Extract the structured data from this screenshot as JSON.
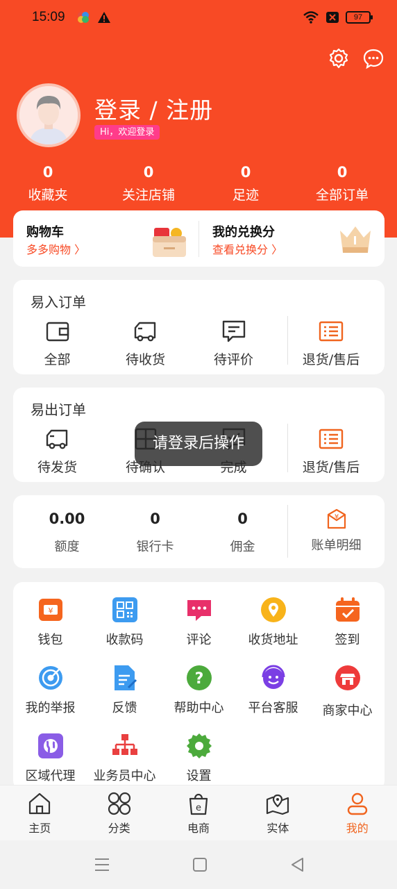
{
  "status": {
    "time": "15:09",
    "battery": "97"
  },
  "profile": {
    "login_text": "登录 / 注册",
    "welcome": "Hi，欢迎登录"
  },
  "stats": [
    {
      "value": "0",
      "label": "收藏夹"
    },
    {
      "value": "0",
      "label": "关注店铺"
    },
    {
      "value": "0",
      "label": "足迹"
    },
    {
      "value": "0",
      "label": "全部订单"
    }
  ],
  "promo": {
    "cart": {
      "title": "购物车",
      "sub": "多多购物 〉"
    },
    "points": {
      "title": "我的兑换分",
      "sub": "查看兑换分 〉"
    }
  },
  "orders_in": {
    "title": "易入订单",
    "items": [
      "全部",
      "待收货",
      "待评价",
      "退货/售后"
    ]
  },
  "orders_out": {
    "title": "易出订单",
    "items": [
      "待发货",
      "待确认",
      "完成",
      "退货/售后"
    ]
  },
  "wallet": {
    "items": [
      {
        "value": "0.00",
        "label": "额度"
      },
      {
        "value": "0",
        "label": "银行卡"
      },
      {
        "value": "0",
        "label": "佣金"
      }
    ],
    "bill": "账单明细"
  },
  "services": [
    "钱包",
    "收款码",
    "评论",
    "收货地址",
    "签到",
    "我的举报",
    "反馈",
    "帮助中心",
    "平台客服",
    "商家中心",
    "区域代理",
    "业务员中心",
    "设置"
  ],
  "tabs": [
    "主页",
    "分类",
    "电商",
    "实体",
    "我的"
  ],
  "toast": "请登录后操作",
  "colors": {
    "brand": "#f84a25",
    "accent": "#f0641e"
  }
}
